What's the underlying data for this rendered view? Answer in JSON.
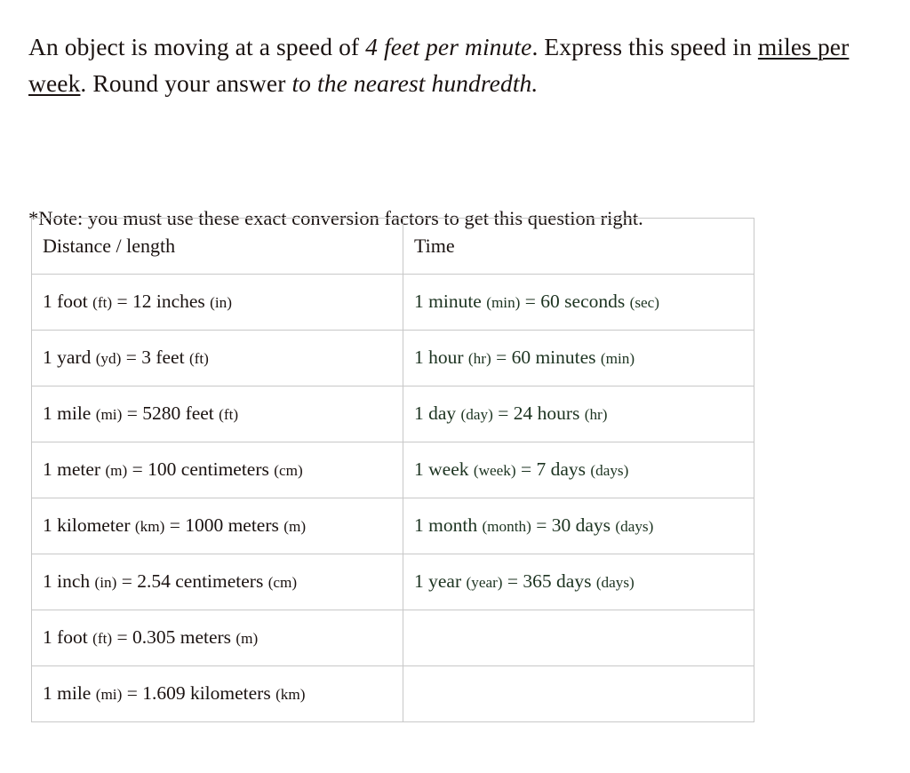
{
  "question": {
    "segments": [
      {
        "text": "An object is moving at a speed of ",
        "style": "normal"
      },
      {
        "text": "4 feet per minute",
        "style": "italic"
      },
      {
        "text": ". Express this speed in ",
        "style": "normal"
      },
      {
        "text": "miles per week",
        "style": "underline"
      },
      {
        "text": ". Round your answer ",
        "style": "normal"
      },
      {
        "text": "to the nearest hundredth",
        "style": "italic"
      },
      {
        "text": ".",
        "style": "italic"
      }
    ],
    "plain_text": "An object is moving at a speed of 4 feet per minute. Express this speed in miles per week. Round your answer to the nearest hundredth.",
    "part_1": "An object is moving at a speed of ",
    "part_italic_1": "4 feet per minute",
    "part_2": ". Express this speed in ",
    "part_underline": "miles per week",
    "part_3": ". Round your answer ",
    "part_italic_2": "to the nearest hundredth",
    "part_4": "."
  },
  "note": "*Note: you must use these exact conversion factors to get this question right.",
  "table": {
    "headers": [
      "Distance / length",
      "Time"
    ],
    "rows": [
      {
        "distance": {
          "lead": "1 foot ",
          "abbr_from": "(ft)",
          "mid": " = 12 inches ",
          "abbr_to": "(in)",
          "full": "1 foot (ft) = 12 inches (in)"
        },
        "time": {
          "lead": "1 minute ",
          "abbr_from": "(min)",
          "mid": " = 60 seconds ",
          "abbr_to": "(sec)",
          "full": "1 minute (min) = 60 seconds (sec)"
        }
      },
      {
        "distance": {
          "lead": "1 yard ",
          "abbr_from": "(yd)",
          "mid": " = 3 feet ",
          "abbr_to": "(ft)",
          "full": "1 yard (yd) = 3 feet (ft)"
        },
        "time": {
          "lead": "1 hour ",
          "abbr_from": "(hr)",
          "mid": " = 60 minutes ",
          "abbr_to": "(min)",
          "full": "1 hour (hr) = 60 minutes (min)"
        }
      },
      {
        "distance": {
          "lead": "1 mile ",
          "abbr_from": "(mi)",
          "mid": " = 5280 feet ",
          "abbr_to": "(ft)",
          "full": "1 mile (mi) = 5280 feet (ft)"
        },
        "time": {
          "lead": "1 day ",
          "abbr_from": "(day)",
          "mid": " = 24 hours ",
          "abbr_to": "(hr)",
          "full": "1 day (day) = 24 hours (hr)"
        }
      },
      {
        "distance": {
          "lead": "1 meter ",
          "abbr_from": "(m)",
          "mid": " = 100 centimeters ",
          "abbr_to": "(cm)",
          "full": "1 meter (m) = 100 centimeters (cm)"
        },
        "time": {
          "lead": "1 week ",
          "abbr_from": "(week)",
          "mid": " = 7 days ",
          "abbr_to": "(days)",
          "full": "1 week (week) = 7 days (days)"
        }
      },
      {
        "distance": {
          "lead": "1 kilometer ",
          "abbr_from": "(km)",
          "mid": " = 1000 meters ",
          "abbr_to": "(m)",
          "full": "1 kilometer (km) = 1000 meters (m)"
        },
        "time": {
          "lead": "1 month ",
          "abbr_from": "(month)",
          "mid": " = 30 days ",
          "abbr_to": "(days)",
          "full": "1 month (month) = 30 days (days)"
        }
      },
      {
        "distance": {
          "lead": "1 inch ",
          "abbr_from": "(in)",
          "mid": " = 2.54 centimeters ",
          "abbr_to": "(cm)",
          "full": "1 inch (in) = 2.54 centimeters (cm)"
        },
        "time": {
          "lead": "1 year ",
          "abbr_from": "(year)",
          "mid": " = 365 days ",
          "abbr_to": "(days)",
          "full": "1 year (year) = 365 days (days)"
        }
      },
      {
        "distance": {
          "lead": "1 foot ",
          "abbr_from": "(ft)",
          "mid": " = 0.305 meters ",
          "abbr_to": "(m)",
          "full": "1 foot (ft) = 0.305 meters (m)"
        },
        "time": {
          "lead": "",
          "abbr_from": "",
          "mid": "",
          "abbr_to": "",
          "full": ""
        }
      },
      {
        "distance": {
          "lead": "1 mile ",
          "abbr_from": "(mi)",
          "mid": " = 1.609 kilometers ",
          "abbr_to": "(km)",
          "full": "1 mile (mi) = 1.609 kilometers (km)"
        },
        "time": {
          "lead": "",
          "abbr_from": "",
          "mid": "",
          "abbr_to": "",
          "full": ""
        }
      }
    ]
  },
  "colors": {
    "background": "#ffffff",
    "text_primary": "#1a1210",
    "text_time_column": "#1c3320",
    "table_border": "#c8c8c8"
  }
}
